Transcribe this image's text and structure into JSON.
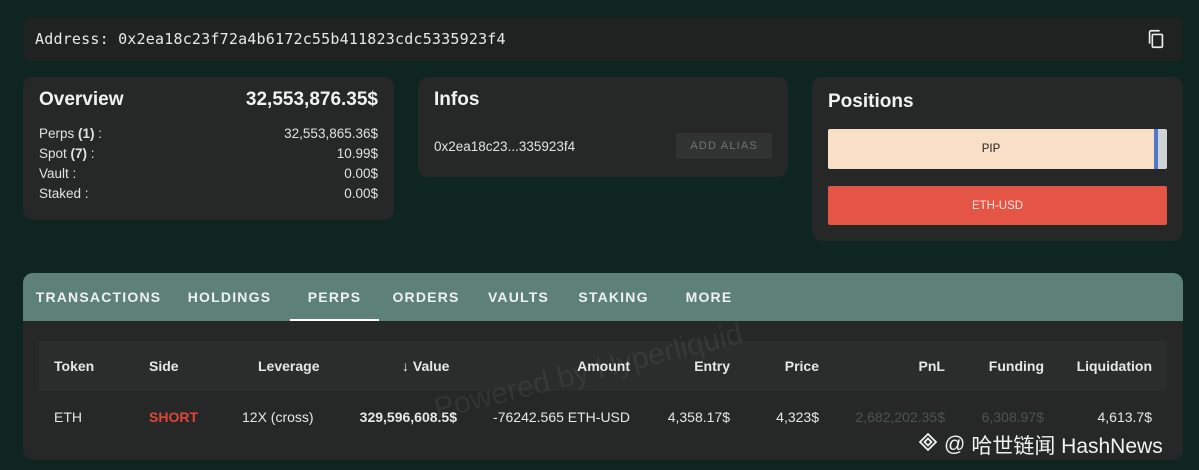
{
  "address_bar": {
    "label": "Address: 0x2ea18c23f72a4b6172c55b411823cdc5335923f4",
    "copy_icon": "copy-icon"
  },
  "overview": {
    "title": "Overview",
    "total": "32,553,876.35$",
    "rows": [
      {
        "label_prefix": "Perps ",
        "count": "(1)",
        "label_suffix": " :",
        "value": "32,553,865.36$"
      },
      {
        "label_prefix": "Spot ",
        "count": "(7)",
        "label_suffix": " :",
        "value": "10.99$"
      },
      {
        "label_prefix": "Vault",
        "count": "",
        "label_suffix": " :",
        "value": "0.00$"
      },
      {
        "label_prefix": "Staked",
        "count": "",
        "label_suffix": " :",
        "value": "0.00$"
      }
    ]
  },
  "infos": {
    "title": "Infos",
    "short_address": "0x2ea18c23...335923f4",
    "add_alias_label": "ADD ALIAS"
  },
  "positions": {
    "title": "Positions",
    "bars": [
      {
        "label": "PIP"
      },
      {
        "label": "ETH-USD"
      }
    ]
  },
  "tabs": [
    "TRANSACTIONS",
    "HOLDINGS",
    "PERPS",
    "ORDERS",
    "VAULTS",
    "STAKING",
    "MORE"
  ],
  "active_tab": "PERPS",
  "table": {
    "columns": {
      "token": "Token",
      "side": "Side",
      "leverage": "Leverage",
      "sort_arrow": "↓",
      "value": "Value",
      "amount": "Amount",
      "entry": "Entry",
      "price": "Price",
      "pnl": "PnL",
      "funding": "Funding",
      "liquidation": "Liquidation"
    },
    "rows": [
      {
        "token": "ETH",
        "side": "SHORT",
        "leverage": "12X (cross)",
        "value": "329,596,608.5$",
        "amount": "-76242.565 ETH-USD",
        "entry": "4,358.17$",
        "price": "4,323$",
        "pnl": "2,682,202.35$",
        "funding": "6,308.97$",
        "liquidation": "4,613.7$"
      }
    ]
  },
  "watermark": "Powered by Hyperliquid",
  "source_mark": {
    "at": "@",
    "text": "哈世链闻 HashNews"
  },
  "colors": {
    "background": "#0f2520",
    "card": "#252827",
    "tab_bar": "#5d8177",
    "short": "#e24638",
    "pip_bar": "#f8dfc5",
    "eth_bar": "#e45545"
  }
}
